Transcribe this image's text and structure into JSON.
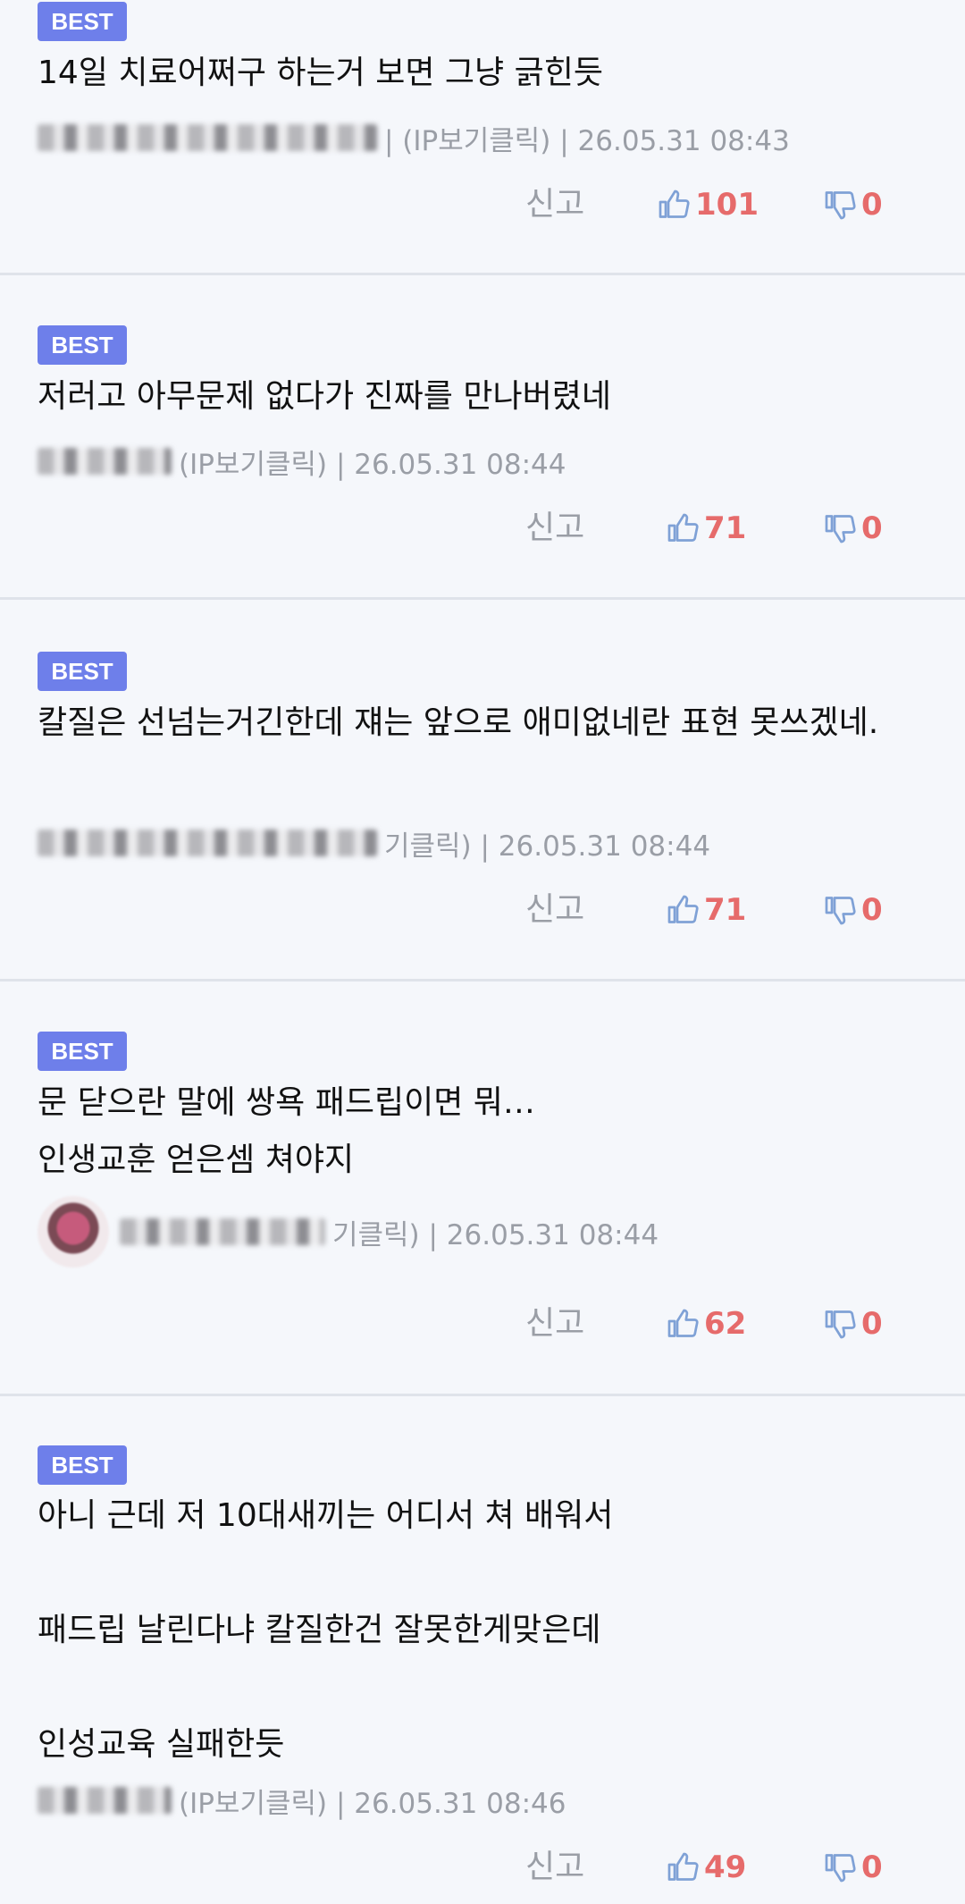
{
  "colors": {
    "background": "#f5f7fb",
    "badge": "#6e7fea",
    "count": "#e66b6b",
    "thumb_icon": "#7fa1d6",
    "meta": "#9a9ea6",
    "divider": "#dfe3ea"
  },
  "comments": [
    {
      "badge": "BEST",
      "text": "14일 치료어쩌구 하는거 보면 그냥 긁힌듯",
      "meta": "| (IP보기클릭) | 26.05.31 08:43",
      "report": "신고",
      "likes": "101",
      "dislikes": "0"
    },
    {
      "badge": "BEST",
      "text": "저러고 아무문제 없다가 진짜를 만나버렸네",
      "meta": "(IP보기클릭) | 26.05.31 08:44",
      "report": "신고",
      "likes": "71",
      "dislikes": "0"
    },
    {
      "badge": "BEST",
      "text": "칼질은 선넘는거긴한데 쟤는 앞으로 애미없네란 표현 못쓰겠네.",
      "meta": "기클릭) | 26.05.31 08:44",
      "report": "신고",
      "likes": "71",
      "dislikes": "0"
    },
    {
      "badge": "BEST",
      "text": "문 닫으란 말에 쌍욕 패드립이면 뭐…\n인생교훈 얻은셈 쳐야지",
      "meta": "기클릭) | 26.05.31 08:44",
      "report": "신고",
      "likes": "62",
      "dislikes": "0"
    },
    {
      "badge": "BEST",
      "text": "아니 근데 저 10대새끼는 어디서 쳐 배워서\n\n패드립 날린다냐 칼질한건 잘못한게맞은데\n\n인성교육 실패한듯",
      "meta": "(IP보기클릭) | 26.05.31 08:46",
      "report": "신고",
      "likes": "49",
      "dislikes": "0"
    }
  ]
}
